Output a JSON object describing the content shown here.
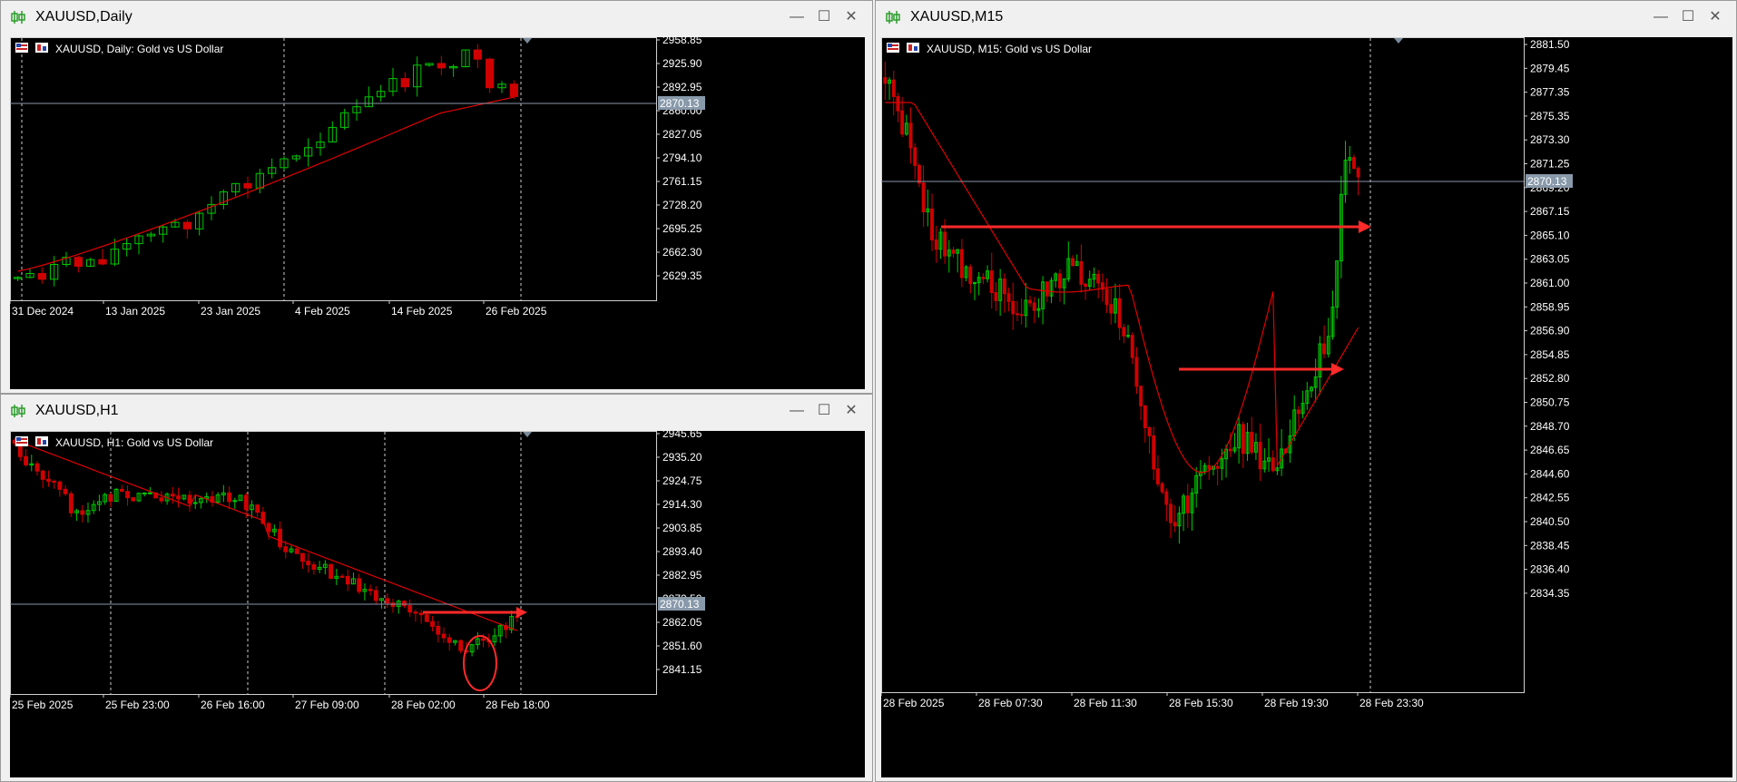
{
  "colors": {
    "bull": "#00c800",
    "bear": "#d00000",
    "ma": "#e00000",
    "grid": "#ffffff",
    "price_line": "#8899aa",
    "price_tag_bg": "#8899aa",
    "arrow": "#ff2a2a"
  },
  "icons": {
    "window": "candlestick-icon",
    "minimize": "minimize-icon",
    "maximize": "maximize-icon",
    "close": "close-icon",
    "chart_logo": "flag-icon",
    "chart_tool": "chart-icon"
  },
  "windows": {
    "daily": {
      "title": "XAUUSD,Daily",
      "chart_label": "XAUUSD, Daily:  Gold vs US Dollar",
      "price_tag": "2870.13",
      "y_ticks": [
        "2958.85",
        "2925.90",
        "2892.95",
        "2860.00",
        "2827.05",
        "2794.10",
        "2761.15",
        "2728.20",
        "2695.25",
        "2662.30",
        "2629.35"
      ],
      "x_ticks": [
        "31 Dec 2024",
        "13 Jan 2025",
        "23 Jan 2025",
        "4 Feb 2025",
        "14 Feb 2025",
        "26 Feb 2025"
      ]
    },
    "h1": {
      "title": "XAUUSD,H1",
      "chart_label": "XAUUSD, H1:  Gold vs US Dollar",
      "price_tag": "2870.13",
      "partial_tick": "2872.50",
      "y_ticks": [
        "2945.65",
        "2935.20",
        "2924.75",
        "2914.30",
        "2903.85",
        "2893.40",
        "2882.95",
        "2862.05",
        "2851.60",
        "2841.15"
      ],
      "x_ticks": [
        "25 Feb 2025",
        "25 Feb 23:00",
        "26 Feb 16:00",
        "27 Feb 09:00",
        "28 Feb 02:00",
        "28 Feb 18:00"
      ]
    },
    "m15": {
      "title": "XAUUSD,M15",
      "chart_label": "XAUUSD, M15:  Gold vs US Dollar",
      "price_tag": "2870.13",
      "y_ticks": [
        "2881.50",
        "2879.45",
        "2877.35",
        "2875.35",
        "2873.30",
        "2871.25",
        "2869.20",
        "2867.15",
        "2865.10",
        "2863.05",
        "2861.00",
        "2858.95",
        "2856.90",
        "2854.85",
        "2852.80",
        "2850.75",
        "2848.70",
        "2846.65",
        "2844.60",
        "2842.55",
        "2840.50",
        "2838.45",
        "2836.40",
        "2834.35"
      ],
      "x_ticks": [
        "28 Feb 2025",
        "28 Feb 07:30",
        "28 Feb 11:30",
        "28 Feb 15:30",
        "28 Feb 19:30",
        "28 Feb 23:30"
      ]
    }
  }
}
